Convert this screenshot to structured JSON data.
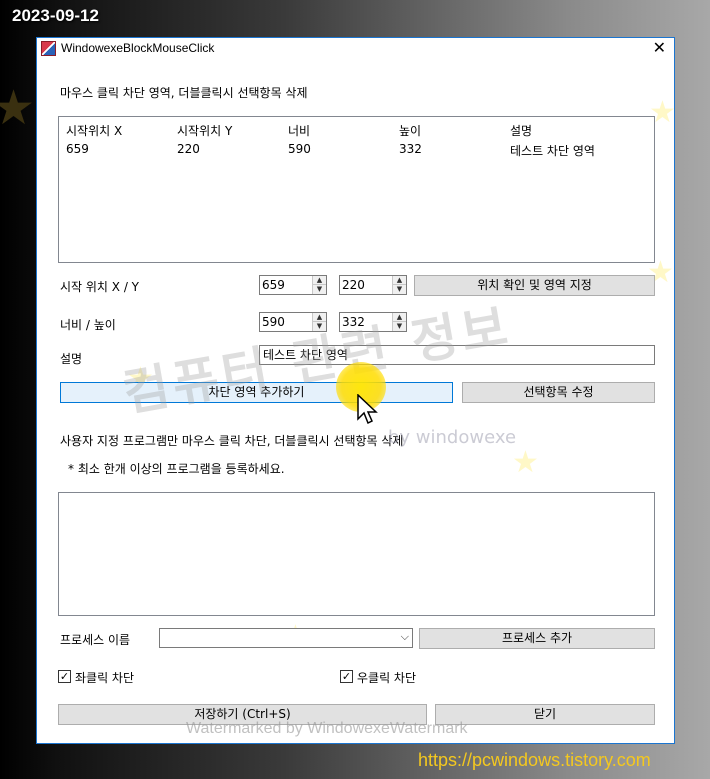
{
  "overlay": {
    "date": "2023-09-12",
    "watermark_main": "컴퓨터 관련 정보",
    "watermark_by": "by windowexe",
    "watermark_bottom": "Watermarked by WindowexeWatermark",
    "site_url": "https://pcwindows.tistory.com"
  },
  "window": {
    "title": "WindowexeBlockMouseClick",
    "close_glyph": "✕"
  },
  "area_section": {
    "heading": "마우스 클릭 차단 영역, 더블클릭시 선택항목 삭제",
    "columns": [
      "시작위치 X",
      "시작위치 Y",
      "너비",
      "높이",
      "설명"
    ],
    "rows": [
      [
        "659",
        "220",
        "590",
        "332",
        "테스트 차단 영역"
      ]
    ],
    "start_pos_label": "시작 위치 X / Y",
    "start_x": "659",
    "start_y": "220",
    "locate_button": "위치 확인 및 영역 지정",
    "size_label": "너비 / 높이",
    "width": "590",
    "height": "332",
    "desc_label": "설명",
    "desc_value": "테스트 차단 영역",
    "add_button": "차단 영역 추가하기",
    "edit_button": "선택항목 수정"
  },
  "program_section": {
    "heading": "사용자 지정 프로그램만 마우스 클릭 차단, 더블클릭시 선택항목 삭제",
    "note": "* 최소 한개 이상의 프로그램을 등록하세요.",
    "process_label": "프로세스 이름",
    "process_value": "",
    "add_process_button": "프로세스 추가"
  },
  "options": {
    "left_click_label": "좌클릭 차단",
    "left_click_checked": true,
    "right_click_label": "우클릭 차단",
    "right_click_checked": true,
    "check_glyph": "✓"
  },
  "footer": {
    "save_button": "저장하기 (Ctrl+S)",
    "close_button": "닫기"
  },
  "spin_glyphs": {
    "up": "▲",
    "down": "▼"
  },
  "combo_glyph": "⌵",
  "icons": [
    "app-icon",
    "close-icon",
    "spin-up-icon",
    "spin-down-icon",
    "dropdown-arrow-icon",
    "checkbox-icon",
    "mouse-cursor-icon"
  ]
}
